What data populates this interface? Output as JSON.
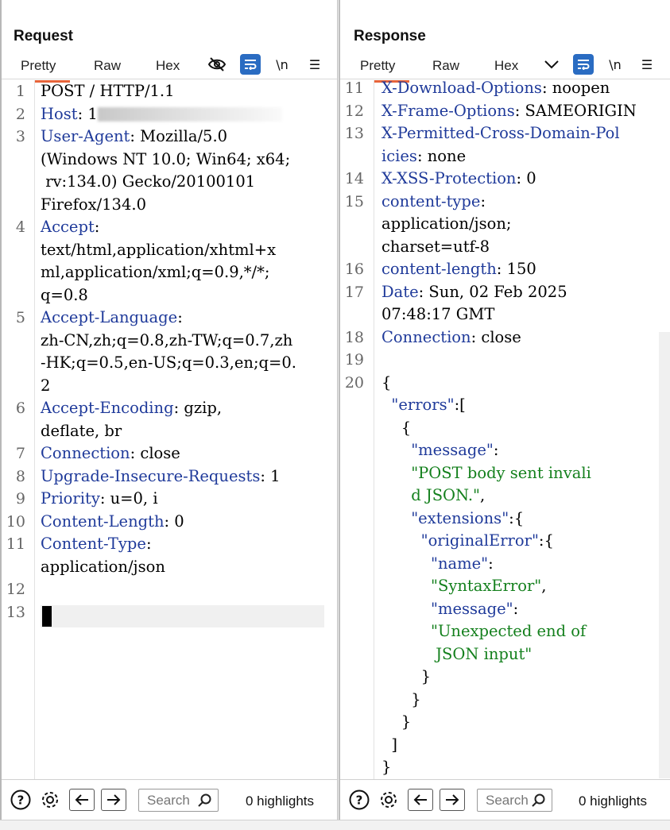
{
  "layout_buttons": [
    "side-by-side",
    "top-bottom",
    "tabs"
  ],
  "request": {
    "title": "Request",
    "tabs": [
      "Pretty",
      "Raw",
      "Hex"
    ],
    "active_tab": "Pretty",
    "tools": {
      "hide": "eye-off-icon",
      "wrap": "word-wrap-icon",
      "newline": "\\n",
      "menu": "☰"
    },
    "lines": [
      {
        "n": "1",
        "segs": [
          [
            [
              "p",
              "POST / HTTP/1.1"
            ]
          ]
        ]
      },
      {
        "n": "2",
        "segs": [
          [
            [
              "k",
              "Host"
            ],
            [
              "p",
              ": 1"
            ],
            [
              "blur",
              ""
            ]
          ]
        ]
      },
      {
        "n": "3",
        "segs": [
          [
            [
              "k",
              "User-Agent"
            ],
            [
              "p",
              ": Mozilla/5.0"
            ]
          ],
          [
            [
              "p",
              "(Windows NT 10.0; Win64; x64;"
            ]
          ],
          [
            [
              "p",
              " rv:134.0) Gecko/20100101"
            ]
          ],
          [
            [
              "p",
              "Firefox/134.0"
            ]
          ]
        ]
      },
      {
        "n": "4",
        "segs": [
          [
            [
              "k",
              "Accept"
            ],
            [
              "p",
              ":"
            ]
          ],
          [
            [
              "p",
              "text/html,application/xhtml+x"
            ]
          ],
          [
            [
              "p",
              "ml,application/xml;q=0.9,*/*;"
            ]
          ],
          [
            [
              "p",
              "q=0.8"
            ]
          ]
        ]
      },
      {
        "n": "5",
        "segs": [
          [
            [
              "k",
              "Accept-Language"
            ],
            [
              "p",
              ":"
            ]
          ],
          [
            [
              "p",
              "zh-CN,zh;q=0.8,zh-TW;q=0.7,zh"
            ]
          ],
          [
            [
              "p",
              "-HK;q=0.5,en-US;q=0.3,en;q=0."
            ]
          ],
          [
            [
              "p",
              "2"
            ]
          ]
        ]
      },
      {
        "n": "6",
        "segs": [
          [
            [
              "k",
              "Accept-Encoding"
            ],
            [
              "p",
              ": gzip,"
            ]
          ],
          [
            [
              "p",
              "deflate, br"
            ]
          ]
        ]
      },
      {
        "n": "7",
        "segs": [
          [
            [
              "k",
              "Connection"
            ],
            [
              "p",
              ": close"
            ]
          ]
        ]
      },
      {
        "n": "8",
        "segs": [
          [
            [
              "k",
              "Upgrade-Insecure-Requests"
            ],
            [
              "p",
              ": 1"
            ]
          ]
        ]
      },
      {
        "n": "9",
        "segs": [
          [
            [
              "k",
              "Priority"
            ],
            [
              "p",
              ": u=0, i"
            ]
          ]
        ]
      },
      {
        "n": "10",
        "segs": [
          [
            [
              "k",
              "Content-Length"
            ],
            [
              "p",
              ": 0"
            ]
          ]
        ]
      },
      {
        "n": "11",
        "segs": [
          [
            [
              "k",
              "Content-Type"
            ],
            [
              "p",
              ":"
            ]
          ],
          [
            [
              "p",
              "application/json"
            ]
          ]
        ]
      },
      {
        "n": "12",
        "segs": [
          [
            [
              "p",
              ""
            ]
          ]
        ]
      },
      {
        "n": "13",
        "segs": [
          [
            [
              "p",
              ""
            ]
          ]
        ]
      }
    ],
    "footer": {
      "search_placeholder": "Search",
      "highlights": "0 highlights"
    }
  },
  "response": {
    "title": "Response",
    "tabs": [
      "Pretty",
      "Raw",
      "Hex"
    ],
    "active_tab": "Pretty",
    "tools": {
      "chevron": "chevron-down-icon",
      "wrap": "word-wrap-icon",
      "newline": "\\n",
      "menu": "☰"
    },
    "lines": [
      {
        "n": "11",
        "segs": [
          [
            [
              "k",
              "X-Download-Options"
            ],
            [
              "p",
              ": noopen"
            ]
          ]
        ]
      },
      {
        "n": "12",
        "segs": [
          [
            [
              "k",
              "X-Frame-Options"
            ],
            [
              "p",
              ": SAMEORIGIN"
            ]
          ]
        ]
      },
      {
        "n": "13",
        "segs": [
          [
            [
              "k",
              "X-Permitted-Cross-Domain-Pol"
            ]
          ],
          [
            [
              "k",
              "icies"
            ],
            [
              "p",
              ": none"
            ]
          ]
        ]
      },
      {
        "n": "14",
        "segs": [
          [
            [
              "k",
              "X-XSS-Protection"
            ],
            [
              "p",
              ": 0"
            ]
          ]
        ]
      },
      {
        "n": "15",
        "segs": [
          [
            [
              "k",
              "content-type"
            ],
            [
              "p",
              ":"
            ]
          ],
          [
            [
              "p",
              "application/json;"
            ]
          ],
          [
            [
              "p",
              "charset=utf-8"
            ]
          ]
        ]
      },
      {
        "n": "16",
        "segs": [
          [
            [
              "k",
              "content-length"
            ],
            [
              "p",
              ": 150"
            ]
          ]
        ]
      },
      {
        "n": "17",
        "segs": [
          [
            [
              "k",
              "Date"
            ],
            [
              "p",
              ": Sun, 02 Feb 2025"
            ]
          ],
          [
            [
              "p",
              "07:48:17 GMT"
            ]
          ]
        ]
      },
      {
        "n": "18",
        "segs": [
          [
            [
              "k",
              "Connection"
            ],
            [
              "p",
              ": close"
            ]
          ]
        ]
      },
      {
        "n": "19",
        "segs": [
          [
            [
              "p",
              ""
            ]
          ]
        ]
      },
      {
        "n": "20",
        "segs": [
          [
            [
              "p",
              "{"
            ]
          ],
          [
            [
              "p",
              "  "
            ],
            [
              "jk",
              "\"errors\""
            ],
            [
              "p",
              ":["
            ]
          ],
          [
            [
              "p",
              "    {"
            ]
          ],
          [
            [
              "p",
              "      "
            ],
            [
              "jk",
              "\"message\""
            ],
            [
              "p",
              ":"
            ]
          ],
          [
            [
              "p",
              "      "
            ],
            [
              "js",
              "\"POST body sent invali"
            ]
          ],
          [
            [
              "p",
              "      "
            ],
            [
              "js",
              "d JSON.\""
            ],
            [
              "p",
              ","
            ]
          ],
          [
            [
              "p",
              "      "
            ],
            [
              "jk",
              "\"extensions\""
            ],
            [
              "p",
              ":{"
            ]
          ],
          [
            [
              "p",
              "        "
            ],
            [
              "jk",
              "\"originalError\""
            ],
            [
              "p",
              ":{"
            ]
          ],
          [
            [
              "p",
              "          "
            ],
            [
              "jk",
              "\"name\""
            ],
            [
              "p",
              ":"
            ]
          ],
          [
            [
              "p",
              "          "
            ],
            [
              "js",
              "\"SyntaxError\""
            ],
            [
              "p",
              ","
            ]
          ],
          [
            [
              "p",
              "          "
            ],
            [
              "jk",
              "\"message\""
            ],
            [
              "p",
              ":"
            ]
          ],
          [
            [
              "p",
              "          "
            ],
            [
              "js",
              "\"Unexpected end of"
            ]
          ],
          [
            [
              "p",
              "           "
            ],
            [
              "js",
              "JSON input\""
            ]
          ],
          [
            [
              "p",
              "        }"
            ]
          ],
          [
            [
              "p",
              "      }"
            ]
          ],
          [
            [
              "p",
              "    }"
            ]
          ],
          [
            [
              "p",
              "  ]"
            ]
          ],
          [
            [
              "p",
              "}"
            ]
          ]
        ]
      }
    ],
    "footer": {
      "search_placeholder": "Search",
      "highlights": "0 highlights"
    }
  },
  "colors": {
    "header_key": "#1f3a9a",
    "json_string": "#14801d",
    "accent_tab": "#e8643a",
    "tool_blue": "#2a6cc2"
  }
}
